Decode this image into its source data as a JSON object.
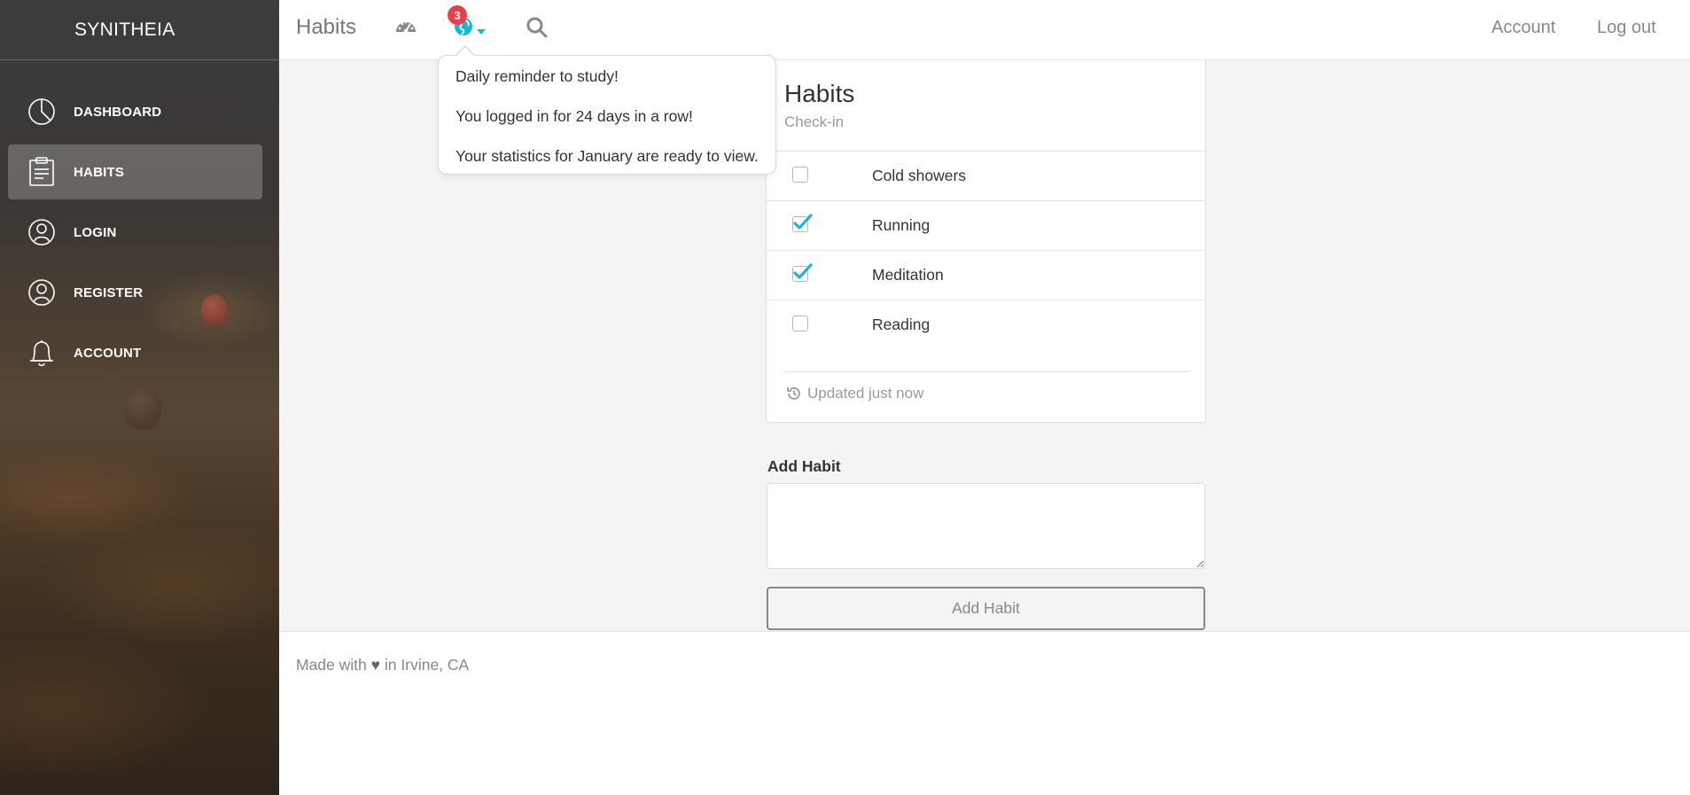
{
  "brand": "SYNITHEIA",
  "sidebar": {
    "items": [
      {
        "label": "DASHBOARD",
        "icon": "pie-chart-icon"
      },
      {
        "label": "HABITS",
        "icon": "clipboard-icon",
        "active": true
      },
      {
        "label": "LOGIN",
        "icon": "user-icon"
      },
      {
        "label": "REGISTER",
        "icon": "user-icon"
      },
      {
        "label": "ACCOUNT",
        "icon": "bell-icon"
      }
    ]
  },
  "topbar": {
    "title": "Habits",
    "notification_count": "3",
    "account_link": "Account",
    "logout_link": "Log out",
    "icons": [
      "dashboard-gauge-icon",
      "globe-icon",
      "caret-down-icon",
      "search-icon"
    ]
  },
  "notifications": [
    "Daily reminder to study!",
    "You logged in for 24 days in a row!",
    "Your statistics for January are ready to view."
  ],
  "card": {
    "title": "Habits",
    "subtitle": "Check-in",
    "habits": [
      {
        "name": "Cold showers",
        "checked": false
      },
      {
        "name": "Running",
        "checked": true
      },
      {
        "name": "Meditation",
        "checked": true
      },
      {
        "name": "Reading",
        "checked": false
      }
    ],
    "footer": "Updated just now"
  },
  "form": {
    "label": "Add Habit",
    "textarea_value": "",
    "button_label": "Add Habit"
  },
  "footer": {
    "prefix": "Made with",
    "heart": "♥",
    "suffix": "in Irvine, CA"
  },
  "colors": {
    "accent": "#1fb5d6",
    "badge": "#e8404d"
  }
}
